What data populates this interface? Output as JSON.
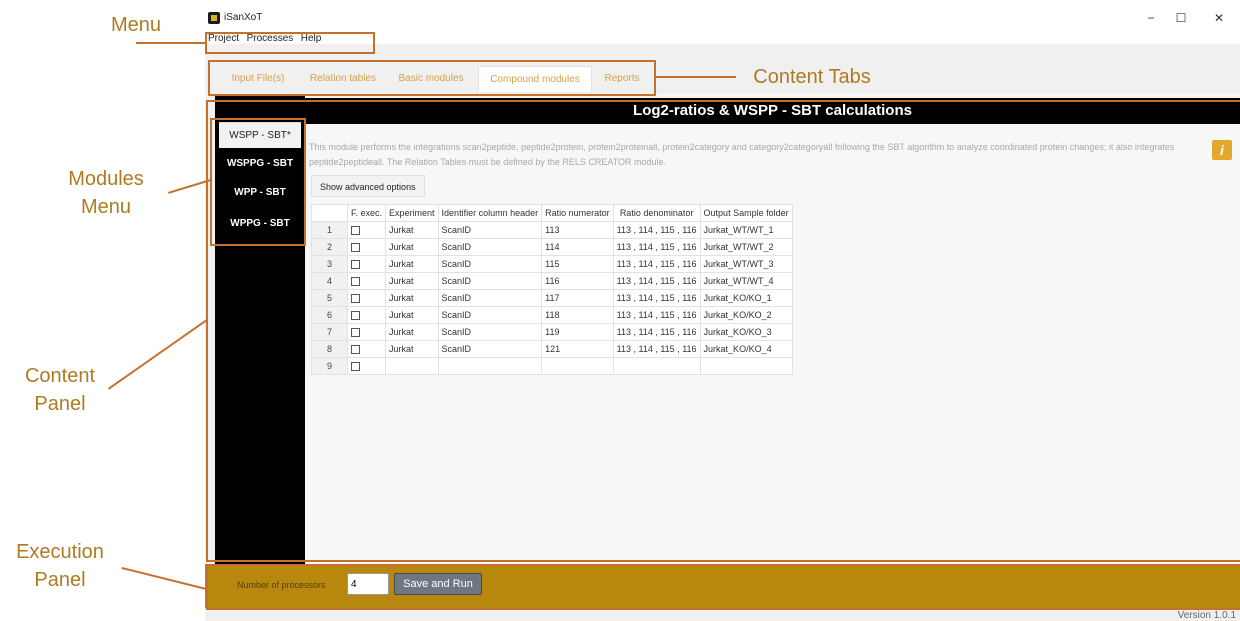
{
  "annotations": {
    "menu": "Menu",
    "content_tabs": "Content Tabs",
    "modules_menu_line1": "Modules",
    "modules_menu_line2": "Menu",
    "content_panel_line1": "Content",
    "content_panel_line2": "Panel",
    "execution_panel_line1": "Execution",
    "execution_panel_line2": "Panel"
  },
  "window": {
    "title": "iSanXoT",
    "minimize": "−",
    "maximize": "☐",
    "close": "✕"
  },
  "menu": [
    "Project",
    "Processes",
    "Help"
  ],
  "tabs": [
    "Input File(s)",
    "Relation tables",
    "Basic modules",
    "Compound modules",
    "Reports"
  ],
  "modules": [
    "WSPP - SBT*",
    "WSPPG - SBT",
    "WPP - SBT",
    "WPPG - SBT"
  ],
  "content": {
    "header": "Log2-ratios & WSPP - SBT calculations",
    "description": "This module performs the integrations scan2peptide, peptide2protein, protein2proteinall, protein2category and category2categoryall following the SBT algorithm to analyze coordinated protein changes; it also integrates peptide2peptideall. The Relation Tables must be defined by the RELS CREATOR module.",
    "info_icon": "i",
    "advanced_button": "Show advanced options"
  },
  "table": {
    "headers": [
      "F. exec.",
      "Experiment",
      "Identifier column header",
      "Ratio numerator",
      "Ratio denominator",
      "Output Sample folder"
    ],
    "rows": [
      {
        "n": "1",
        "exp": "Jurkat",
        "id": "ScanID",
        "num": "113",
        "den": "113 , 114 , 115 , 116",
        "out": "Jurkat_WT/WT_1"
      },
      {
        "n": "2",
        "exp": "Jurkat",
        "id": "ScanID",
        "num": "114",
        "den": "113 , 114 , 115 , 116",
        "out": "Jurkat_WT/WT_2"
      },
      {
        "n": "3",
        "exp": "Jurkat",
        "id": "ScanID",
        "num": "115",
        "den": "113 , 114 , 115 , 116",
        "out": "Jurkat_WT/WT_3"
      },
      {
        "n": "4",
        "exp": "Jurkat",
        "id": "ScanID",
        "num": "116",
        "den": "113 , 114 , 115 , 116",
        "out": "Jurkat_WT/WT_4"
      },
      {
        "n": "5",
        "exp": "Jurkat",
        "id": "ScanID",
        "num": "117",
        "den": "113 , 114 , 115 , 116",
        "out": "Jurkat_KO/KO_1"
      },
      {
        "n": "6",
        "exp": "Jurkat",
        "id": "ScanID",
        "num": "118",
        "den": "113 , 114 , 115 , 116",
        "out": "Jurkat_KO/KO_2"
      },
      {
        "n": "7",
        "exp": "Jurkat",
        "id": "ScanID",
        "num": "119",
        "den": "113 , 114 , 115 , 116",
        "out": "Jurkat_KO/KO_3"
      },
      {
        "n": "8",
        "exp": "Jurkat",
        "id": "ScanID",
        "num": "121",
        "den": "113 , 114 , 115 , 116",
        "out": "Jurkat_KO/KO_4"
      },
      {
        "n": "9",
        "exp": "",
        "id": "",
        "num": "",
        "den": "",
        "out": ""
      }
    ]
  },
  "execution": {
    "processors_label": "Number of processors",
    "processors_value": "4",
    "run_button": "Save and Run"
  },
  "version": "Version 1.0.1",
  "colors": {
    "accent": "#b7870e",
    "tab_text": "#d4a24a",
    "annotation": "#c4702f"
  }
}
